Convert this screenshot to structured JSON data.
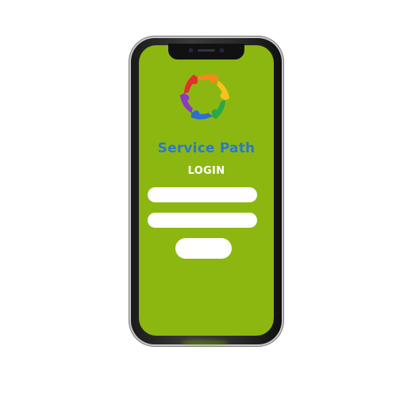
{
  "app": {
    "title": "Service Path",
    "logo_icon": "people-circle-logo-icon"
  },
  "login": {
    "heading": "LOGIN",
    "username_value": "",
    "password_value": "",
    "submit_label": ""
  },
  "colors": {
    "screen_background": "#8cb710",
    "title_text": "#2b79c8",
    "heading_text": "#ffffff",
    "field_background": "#ffffff",
    "phone_frame": "#1b1b1b"
  }
}
